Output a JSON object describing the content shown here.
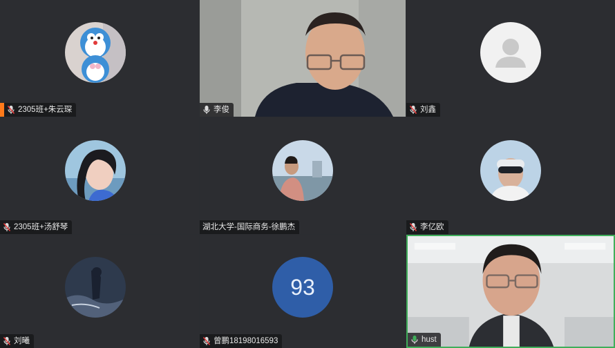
{
  "participants": [
    {
      "name": "2305班+朱云琛",
      "muted": true,
      "speaking": true,
      "kind": "avatar",
      "avatar_icon": "doraemon-avatar"
    },
    {
      "name": "李俊",
      "muted": false,
      "speaking": false,
      "kind": "video",
      "avatar_icon": "camera-video"
    },
    {
      "name": "刘鑫",
      "muted": true,
      "speaking": false,
      "kind": "avatar",
      "avatar_icon": "default-user-icon"
    },
    {
      "name": "2305班+汤舒琴",
      "muted": true,
      "speaking": false,
      "kind": "avatar",
      "avatar_icon": "photo-avatar"
    },
    {
      "name": "湖北大学-国际商务-徐鹏杰",
      "muted": false,
      "speaking": false,
      "kind": "avatar",
      "avatar_icon": "photo-avatar"
    },
    {
      "name": "李亿欧",
      "muted": true,
      "speaking": false,
      "kind": "avatar",
      "avatar_icon": "photo-avatar"
    },
    {
      "name": "刘曦",
      "muted": true,
      "speaking": false,
      "kind": "avatar",
      "avatar_icon": "photo-avatar"
    },
    {
      "name": "曾鹏18198016593",
      "muted": true,
      "speaking": false,
      "kind": "number-avatar",
      "avatar_text": "93"
    },
    {
      "name": "hust",
      "muted": false,
      "speaking": false,
      "kind": "video",
      "active": true,
      "avatar_icon": "camera-video"
    }
  ],
  "colors": {
    "tile_bg": "#2c2d31",
    "active_border": "#3fae5a",
    "speaking_indicator": "#ff7a1a",
    "number_avatar_bg": "#2f5ea8"
  }
}
